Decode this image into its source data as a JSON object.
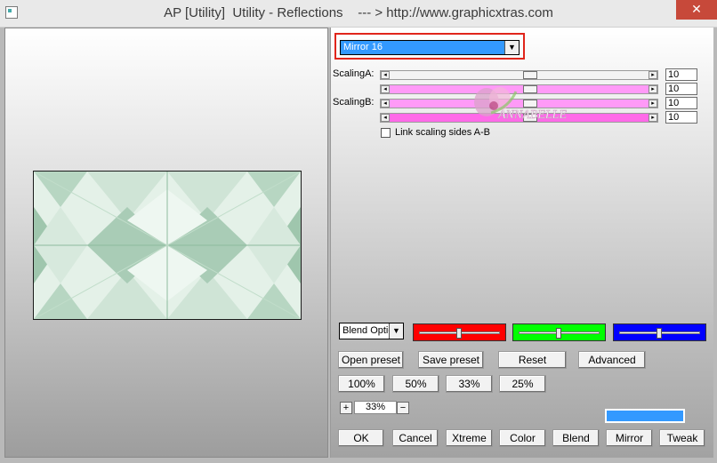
{
  "window": {
    "title": "AP [Utility]  Utility - Reflections    --- > http://www.graphicxtras.com",
    "close_glyph": "✕"
  },
  "filter": {
    "selected": "Mirror 16",
    "arrow_glyph": "▼"
  },
  "params": {
    "scaling_a_label": "ScalingA:",
    "scaling_b_label": "ScalingB:",
    "sliders": [
      {
        "value": "10",
        "color": "#f3f3f3"
      },
      {
        "value": "10",
        "color": "#ff9af7"
      },
      {
        "value": "10",
        "color": "#ff9af7"
      },
      {
        "value": "10",
        "color": "#ff6ae8"
      }
    ],
    "link_label": "Link scaling sides A-B",
    "link_checked": false
  },
  "blend": {
    "selected": "Blend Options",
    "colors": [
      "#ff0000",
      "#00ff00",
      "#0000ff"
    ]
  },
  "buttons": {
    "open_preset": "Open preset",
    "save_preset": "Save preset",
    "reset": "Reset",
    "advanced": "Advanced",
    "zoom_100": "100%",
    "zoom_50": "50%",
    "zoom_33": "33%",
    "zoom_25": "25%",
    "ok": "OK",
    "cancel": "Cancel",
    "xtreme": "Xtreme",
    "color": "Color",
    "blend": "Blend",
    "mirror": "Mirror",
    "tweak": "Tweak"
  },
  "zoom": {
    "value": "33%",
    "plus": "+",
    "minus": "−"
  },
  "watermark_text": "ANNABELLE",
  "accent_colors": {
    "select_highlight": "#3399ff",
    "frame": "#e0251b",
    "swatch": "#3399ff"
  }
}
